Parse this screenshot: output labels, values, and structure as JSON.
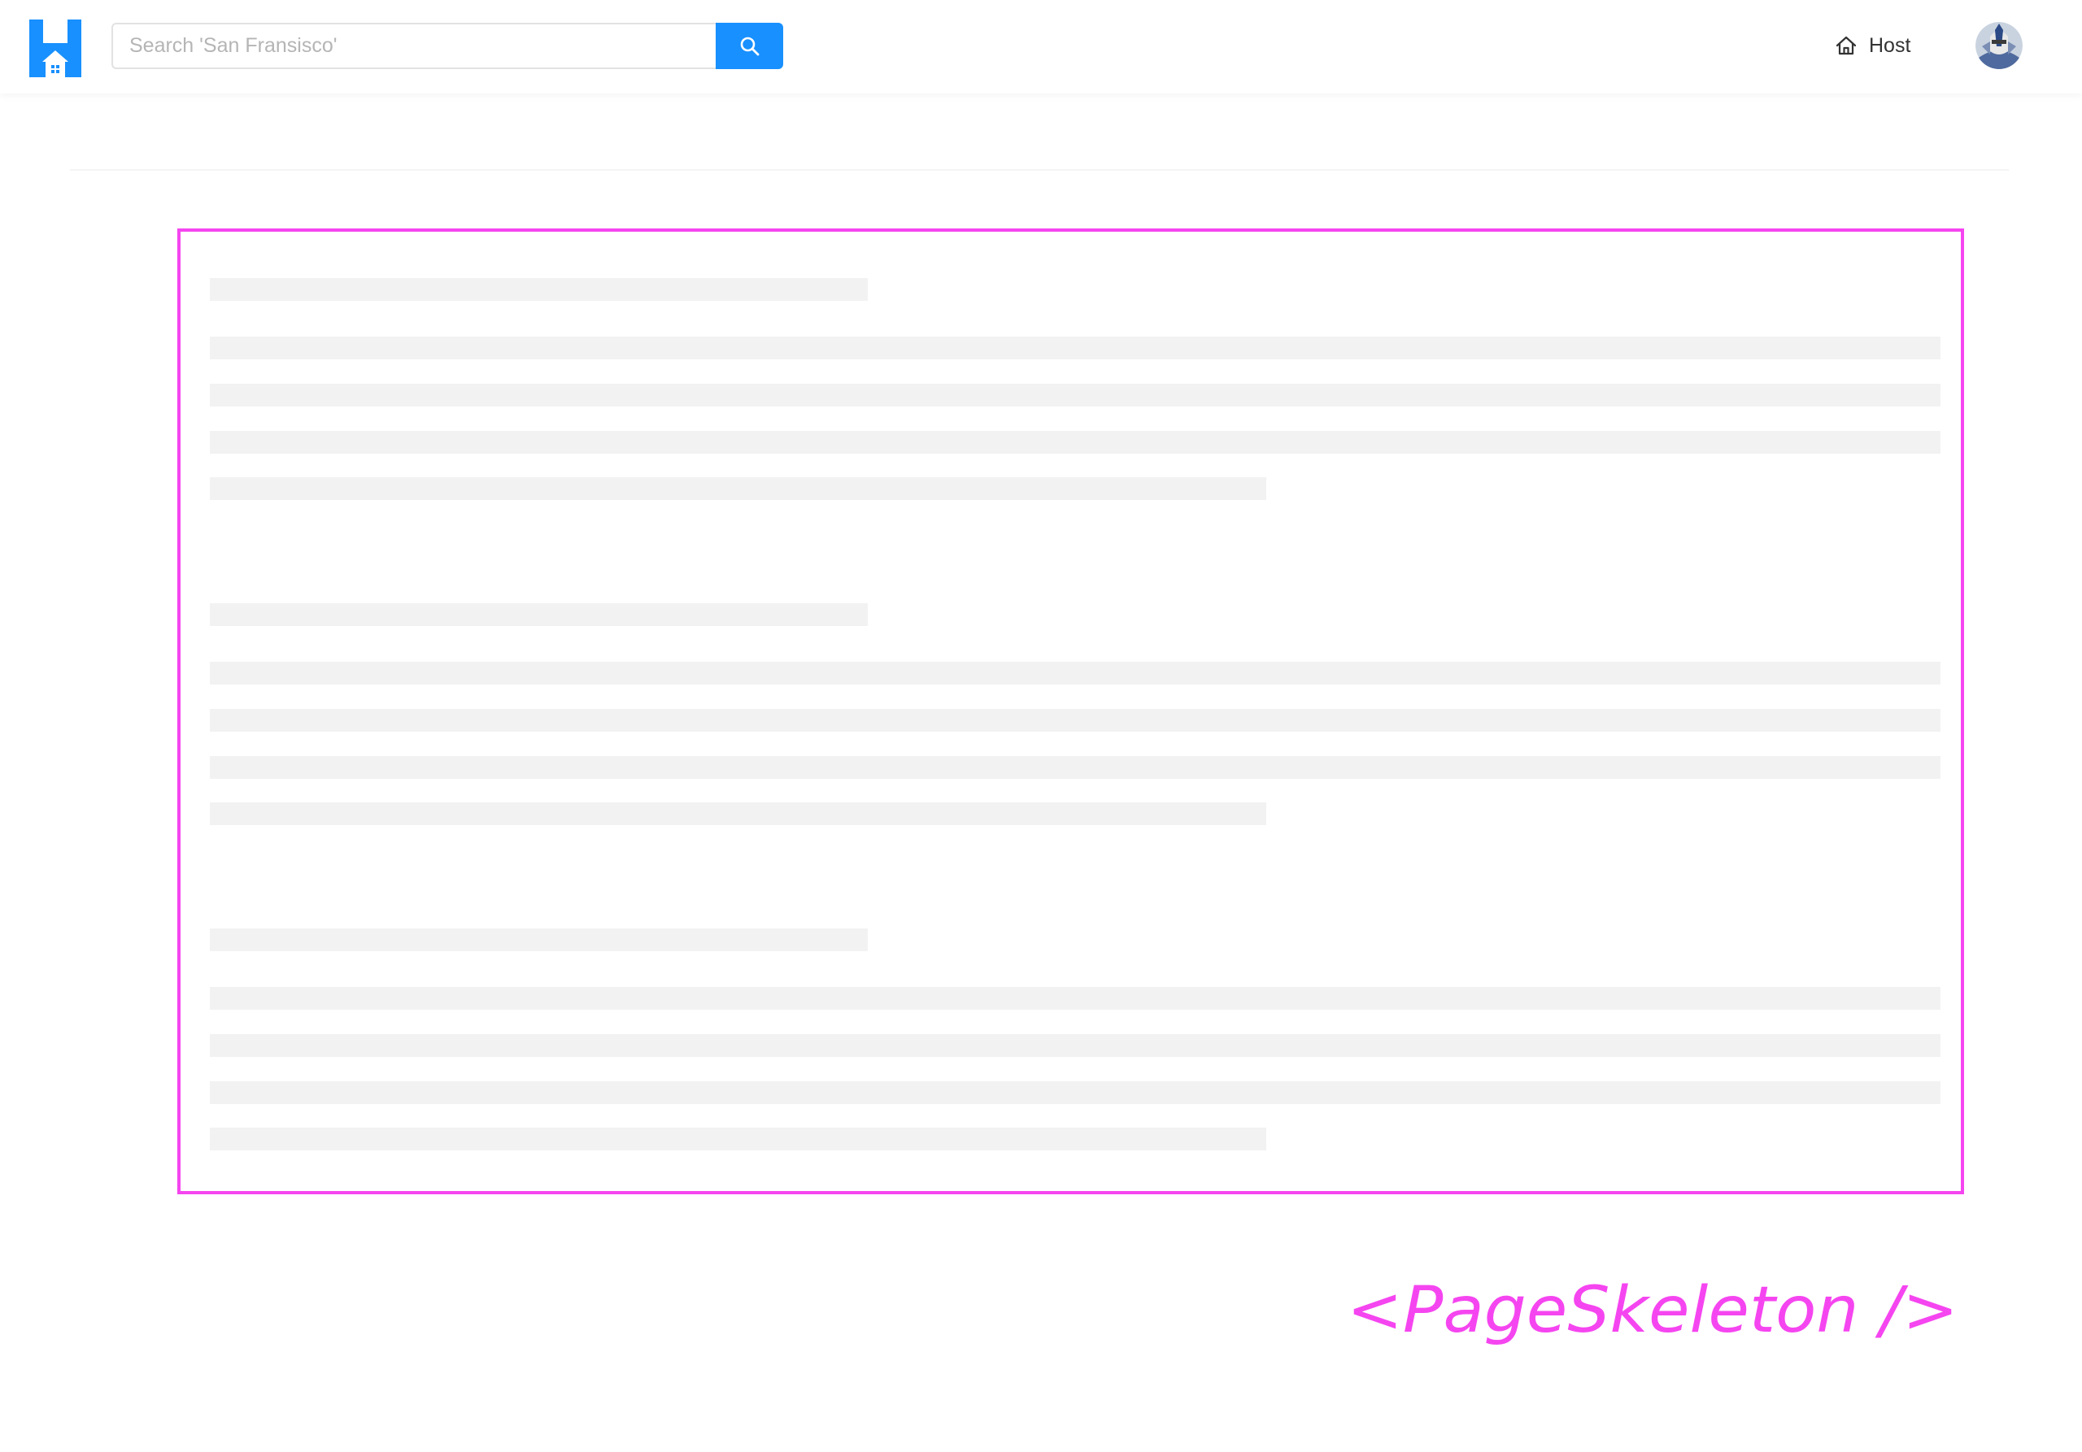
{
  "header": {
    "search": {
      "placeholder": "Search 'San Fransisco'"
    },
    "host_label": "Host"
  },
  "caption": "<PageSkeleton />",
  "colors": {
    "brand": "#1890ff",
    "accent_magenta": "#f545f0",
    "skeleton_bar": "#f2f2f2"
  }
}
